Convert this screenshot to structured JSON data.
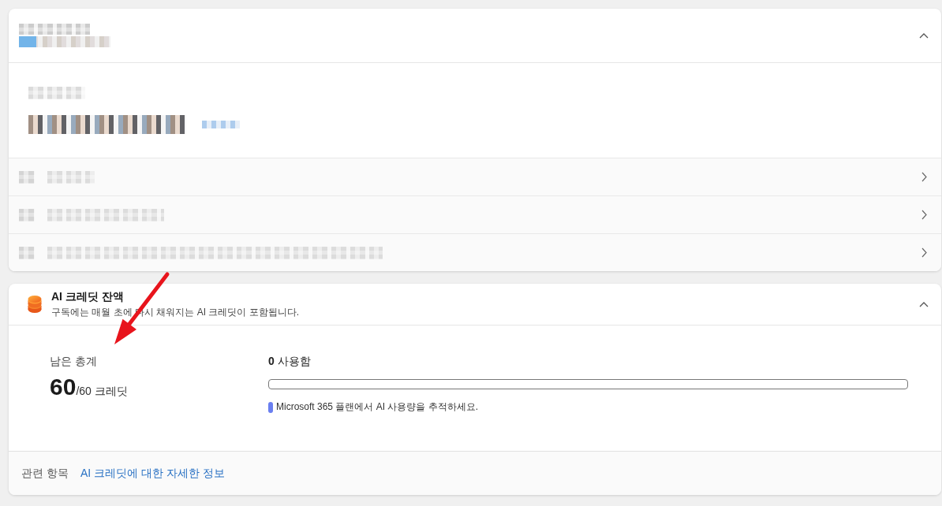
{
  "account_card": {
    "redacted": true,
    "expanded": true,
    "rows": [
      {
        "kind": "link"
      },
      {
        "kind": "link"
      },
      {
        "kind": "link"
      }
    ]
  },
  "credits_card": {
    "title": "AI 크레딧 잔액",
    "subtitle": "구독에는 매월 초에 다시 채워지는 AI 크레딧이 포함됩니다.",
    "expanded": true,
    "remaining": {
      "label": "남은 총계",
      "value": "60",
      "total": "/60 크레딧"
    },
    "usage": {
      "label": "**0** 사용함",
      "level": 0,
      "note": "Microsoft 365 플랜에서 AI 사용량을 추적하세요."
    },
    "footer": {
      "label": "관련 항목",
      "link": "AI 크레딧에 대한 자세한 정보"
    }
  },
  "annotations": [
    {
      "kind": "arrow"
    }
  ]
}
